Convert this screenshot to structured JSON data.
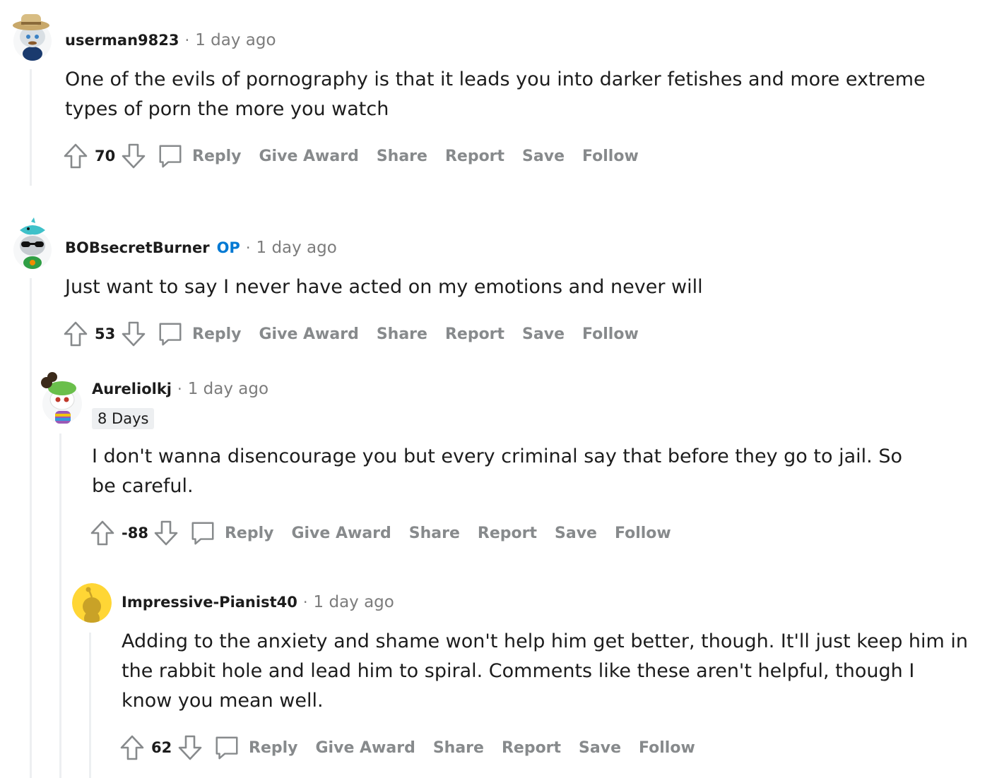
{
  "comments": [
    {
      "username": "userman9823",
      "op_badge": "",
      "separator": "·",
      "time": "1 day ago",
      "flair": "",
      "body": "One of the evils of pornography is that it leads you into darker fetishes and more extreme types of porn the more you watch",
      "score": "70",
      "actions": {
        "reply": "Reply",
        "award": "Give Award",
        "share": "Share",
        "report": "Report",
        "save": "Save",
        "follow": "Follow"
      }
    },
    {
      "username": "BOBsecretBurner",
      "op_badge": "OP",
      "separator": "·",
      "time": "1 day ago",
      "flair": "",
      "body": "Just want to say I never have acted on my emotions and never will",
      "score": "53",
      "actions": {
        "reply": "Reply",
        "award": "Give Award",
        "share": "Share",
        "report": "Report",
        "save": "Save",
        "follow": "Follow"
      }
    },
    {
      "username": "Aureliolkj",
      "op_badge": "",
      "separator": "·",
      "time": "1 day ago",
      "flair": "8 Days",
      "body": "I don't wanna disencourage you but every criminal say that before they go to jail. So be careful.",
      "score": "-88",
      "actions": {
        "reply": "Reply",
        "award": "Give Award",
        "share": "Share",
        "report": "Report",
        "save": "Save",
        "follow": "Follow"
      }
    },
    {
      "username": "Impressive-Pianist40",
      "op_badge": "",
      "separator": "·",
      "time": "1 day ago",
      "flair": "",
      "body": "Adding to the anxiety and shame won't help him get better, though. It'll just keep him in the rabbit hole and lead him to spiral. Comments like these aren't helpful, though I know you mean well.",
      "score": "62",
      "actions": {
        "reply": "Reply",
        "award": "Give Award",
        "share": "Share",
        "report": "Report",
        "save": "Save",
        "follow": "Follow"
      }
    }
  ],
  "icons": {
    "upvote": "upvote-arrow-icon",
    "downvote": "downvote-arrow-icon",
    "comment": "comment-bubble-icon"
  },
  "colors": {
    "op_badge": "#0079d3",
    "action_text": "#878a8c",
    "meta_text": "#7c7c7c",
    "thread_line": "#edeff1"
  }
}
